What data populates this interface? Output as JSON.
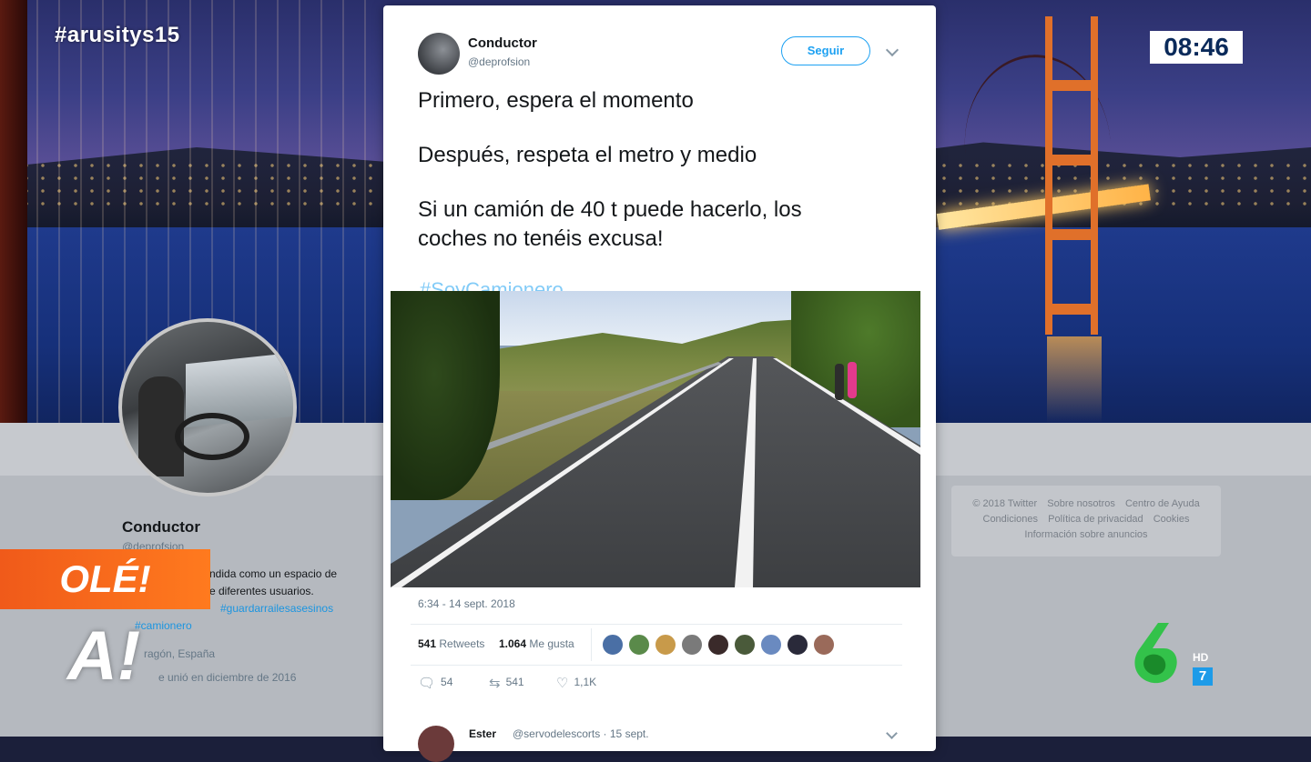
{
  "overlay": {
    "hashtag": "#arusitys15",
    "clock": "08:46",
    "ole_banner": "OLÉ!",
    "program_logo": "A!",
    "channel_hd": "HD",
    "channel_number": "7"
  },
  "profile": {
    "name": "Conductor",
    "handle": "@deprofsion",
    "bio_line1": "ndida como un espacio de",
    "bio_line2": "e diferentes usuarios.",
    "bio_line3_tag": "#guardarrailesasesinos",
    "bio_line4_tag": "#camionero",
    "location": "ragón, España",
    "joined": "e unió en diciembre de 2016"
  },
  "footer": {
    "links_row1": [
      "© 2018 Twitter",
      "Sobre nosotros",
      "Centro de Ayuda"
    ],
    "links_row2": [
      "Condiciones",
      "Política de privacidad",
      "Cookies"
    ],
    "links_row3": [
      "Información sobre anuncios"
    ]
  },
  "tweet": {
    "author_name": "Conductor",
    "author_handle": "@deprofsion",
    "follow_label": "Seguir",
    "text_line1": "Primero, espera el momento",
    "text_line2": "Después, respeta el metro y medio",
    "text_line3": "Si un camión de 40 t puede hacerlo, los",
    "text_line4": "coches no tenéis excusa!",
    "hashtag": "#SoyCamionero",
    "timestamp": "6:34 - 14 sept. 2018",
    "retweets_count": "541",
    "retweets_label": "Retweets",
    "likes_count": "1.064",
    "likes_label": "Me gusta",
    "liker_colors": [
      "#4a6fa5",
      "#5a8a4a",
      "#c89a4a",
      "#7a7a7a",
      "#3a2a2a",
      "#4a5a3a",
      "#6a8ac0",
      "#2a2a3a",
      "#9a6a5a"
    ],
    "actions": {
      "reply_count": "54",
      "retweet_count": "541",
      "like_count": "1,1K"
    }
  },
  "reply_preview": {
    "name": "Ester",
    "handle": "@servodelescorts · 15 sept."
  }
}
